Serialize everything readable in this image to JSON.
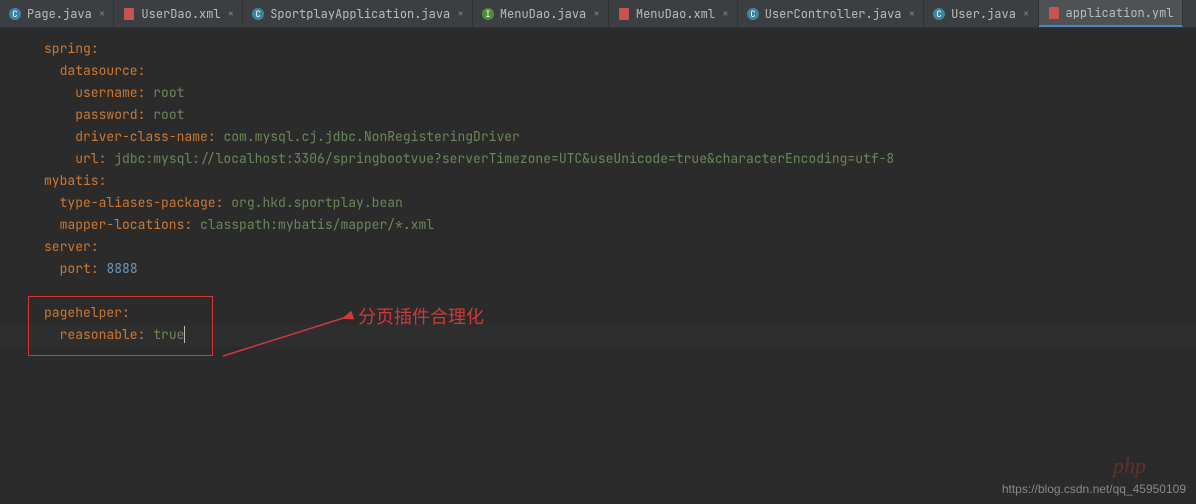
{
  "tabs": [
    {
      "label": "Page.java",
      "icon": "java-class-icon",
      "color": "#3e86a0"
    },
    {
      "label": "UserDao.xml",
      "icon": "xml-file-icon",
      "color": "#c75450"
    },
    {
      "label": "SportplayApplication.java",
      "icon": "java-class-icon",
      "color": "#3e86a0"
    },
    {
      "label": "MenuDao.java",
      "icon": "java-interface-icon",
      "color": "#548a3a"
    },
    {
      "label": "MenuDao.xml",
      "icon": "xml-file-icon",
      "color": "#c75450"
    },
    {
      "label": "UserController.java",
      "icon": "java-class-icon",
      "color": "#3e86a0"
    },
    {
      "label": "User.java",
      "icon": "java-class-icon",
      "color": "#3e86a0"
    },
    {
      "label": "application.yml",
      "icon": "yml-file-icon",
      "color": "#c75450",
      "active": true
    }
  ],
  "code": {
    "l1_key": "spring",
    "l2_key": "datasource",
    "l3_key": "username",
    "l3_val": "root",
    "l4_key": "password",
    "l4_val": "root",
    "l5_key": "driver-class-name",
    "l5_val": "com.mysql.cj.jdbc.NonRegisteringDriver",
    "l6_key": "url",
    "l6_val": "jdbc:mysql://localhost:3306/springbootvue?serverTimezone=UTC&useUnicode=true&characterEncoding=utf-8",
    "l7_key": "mybatis",
    "l8_key": "type-aliases-package",
    "l8_val": "org.hkd.sportplay.bean",
    "l9_key": "mapper-locations",
    "l9_val": "classpath:mybatis/mapper/*.xml",
    "l10_key": "server",
    "l11_key": "port",
    "l11_val": "8888",
    "l13_key": "pagehelper",
    "l14_key": "reasonable",
    "l14_val": "true"
  },
  "annotation": {
    "text": "分页插件合理化"
  },
  "watermark": {
    "url": "https://blog.csdn.net/qq_45950109",
    "logo": "php"
  },
  "close_glyph": "×"
}
